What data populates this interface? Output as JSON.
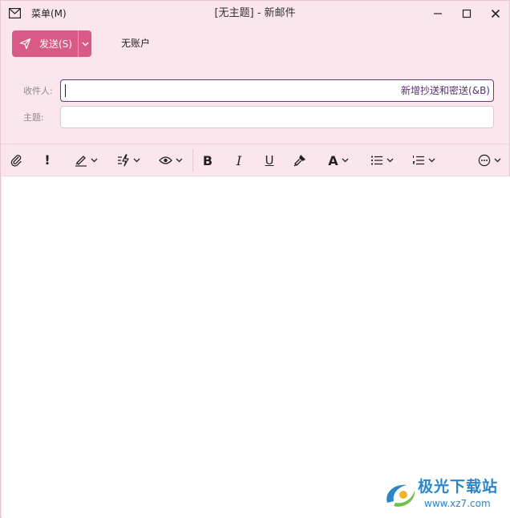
{
  "titlebar": {
    "menu_label": "菜单(M)",
    "window_title": "[无主题] - 新邮件"
  },
  "compose": {
    "send_label": "发送(S)",
    "account_label": "无账户",
    "to_label": "收件人:",
    "subject_label": "主题:",
    "to_value": "",
    "subject_value": "",
    "cc_bcc_label": "新增抄送和密送(&B)"
  },
  "toolbar": {
    "bold": "B",
    "italic": "I",
    "underline": "U",
    "font_color": "A",
    "important": "!"
  },
  "watermark": {
    "brand": "极光下载站",
    "url": "www.xz7.com"
  },
  "colors": {
    "accent": "#d95a86",
    "chrome": "#fbe6ee",
    "focus_border": "#6a3a7a"
  }
}
